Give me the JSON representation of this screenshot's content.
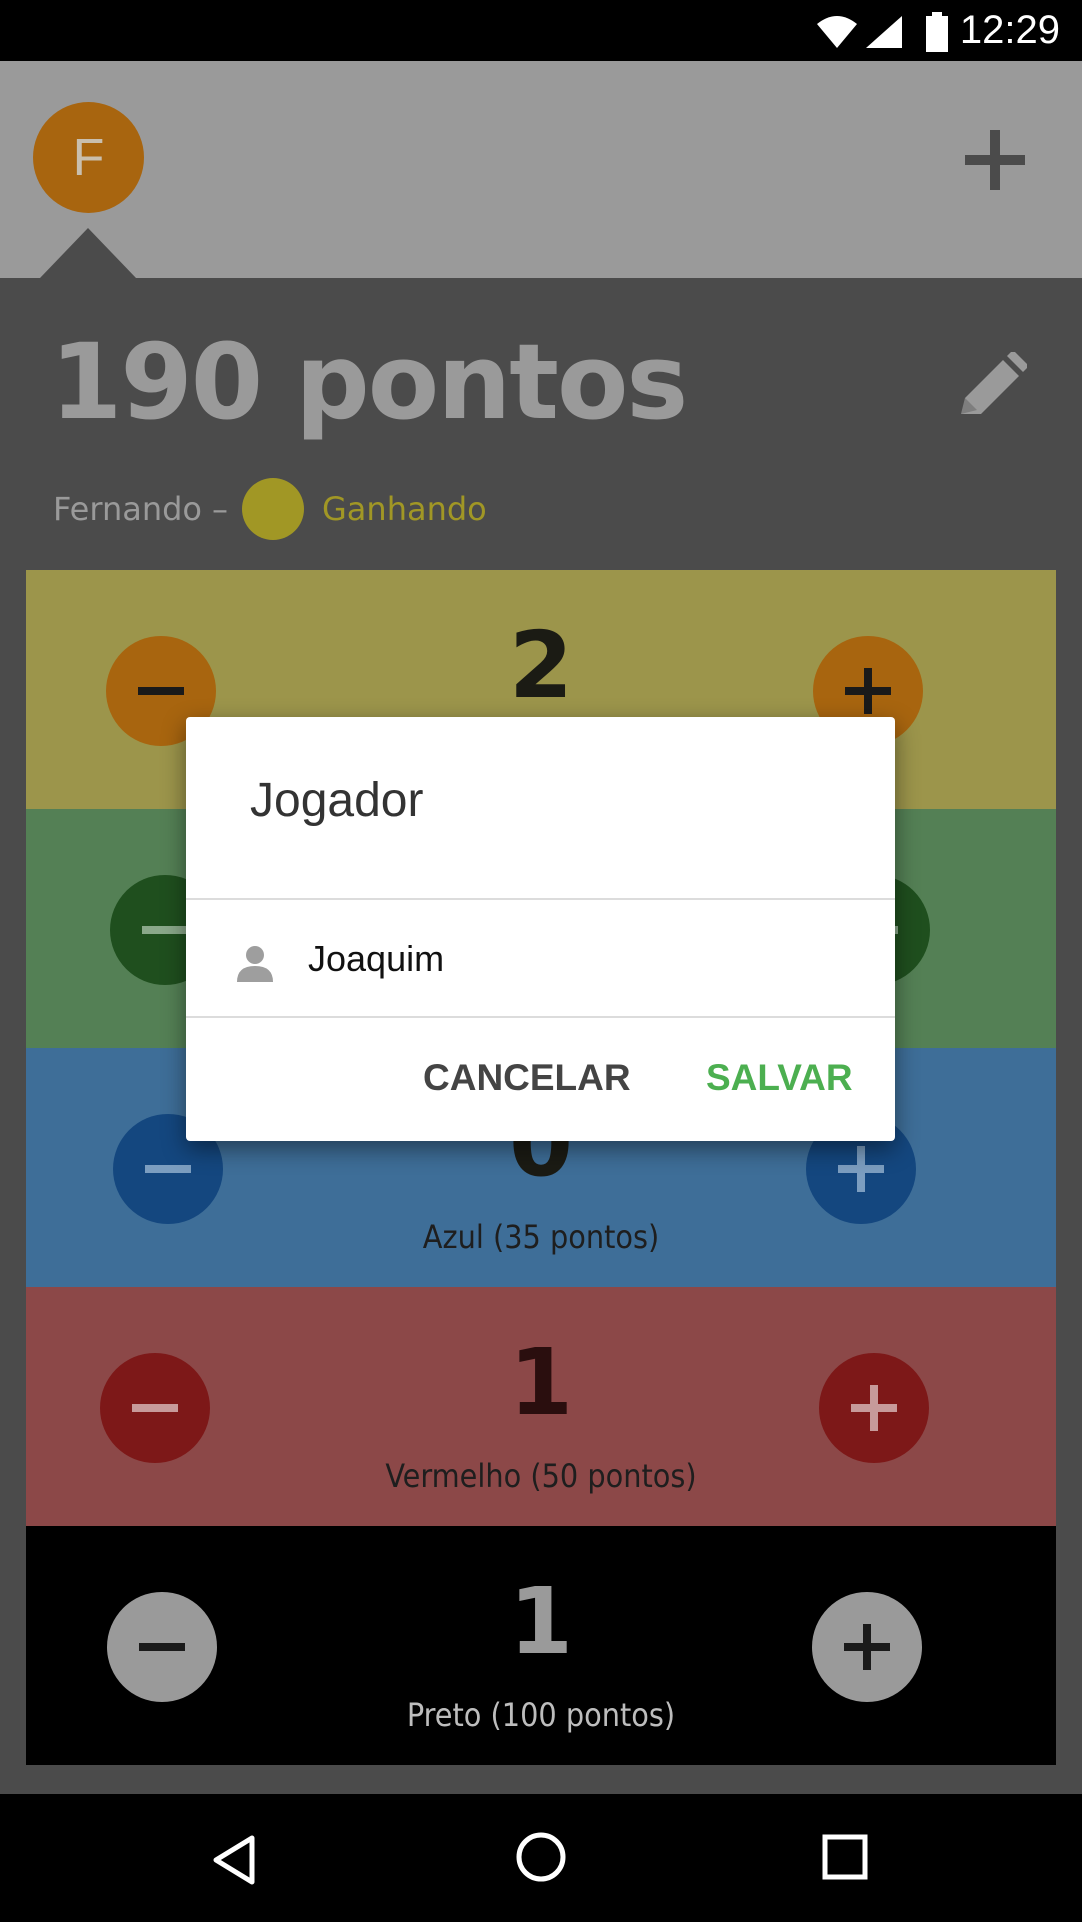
{
  "status_bar": {
    "time": "12:29",
    "icons": [
      "wifi-icon",
      "signal-icon",
      "battery-icon"
    ]
  },
  "header": {
    "avatar_letter": "F",
    "add_icon": "plus-icon"
  },
  "score": {
    "title": "190 pontos",
    "player_name": "Fernando",
    "separator": "–",
    "status": "Ganhando",
    "edit_icon": "pencil-icon"
  },
  "rows": [
    {
      "count": "2",
      "label": "",
      "color": "#9c954b",
      "button_color": "#a8650f",
      "symbol_color": "#1a1a1a"
    },
    {
      "count": "",
      "label": "",
      "color": "#548055",
      "button_color": "#1f4f1e",
      "symbol_color": "#8aa88a"
    },
    {
      "count": "0",
      "label": "Azul (35 pontos)",
      "color": "#3e6e98",
      "button_color": "#14477f",
      "symbol_color": "#7c9ec0"
    },
    {
      "count": "1",
      "label": "Vermelho (50 pontos)",
      "color": "#8c4848",
      "button_color": "#7d1818",
      "symbol_color": "#c79a9a"
    },
    {
      "count": "1",
      "label": "Preto (100 pontos)",
      "color": "#000000",
      "button_color": "#9a9a9a",
      "symbol_color": "#1a1a1a"
    }
  ],
  "dialog": {
    "title": "Jogador",
    "input_value": "Joaquim",
    "cancel_label": "CANCELAR",
    "save_label": "SALVAR"
  },
  "nav_bar": {
    "icons": [
      "back-icon",
      "home-icon",
      "recents-icon"
    ]
  }
}
